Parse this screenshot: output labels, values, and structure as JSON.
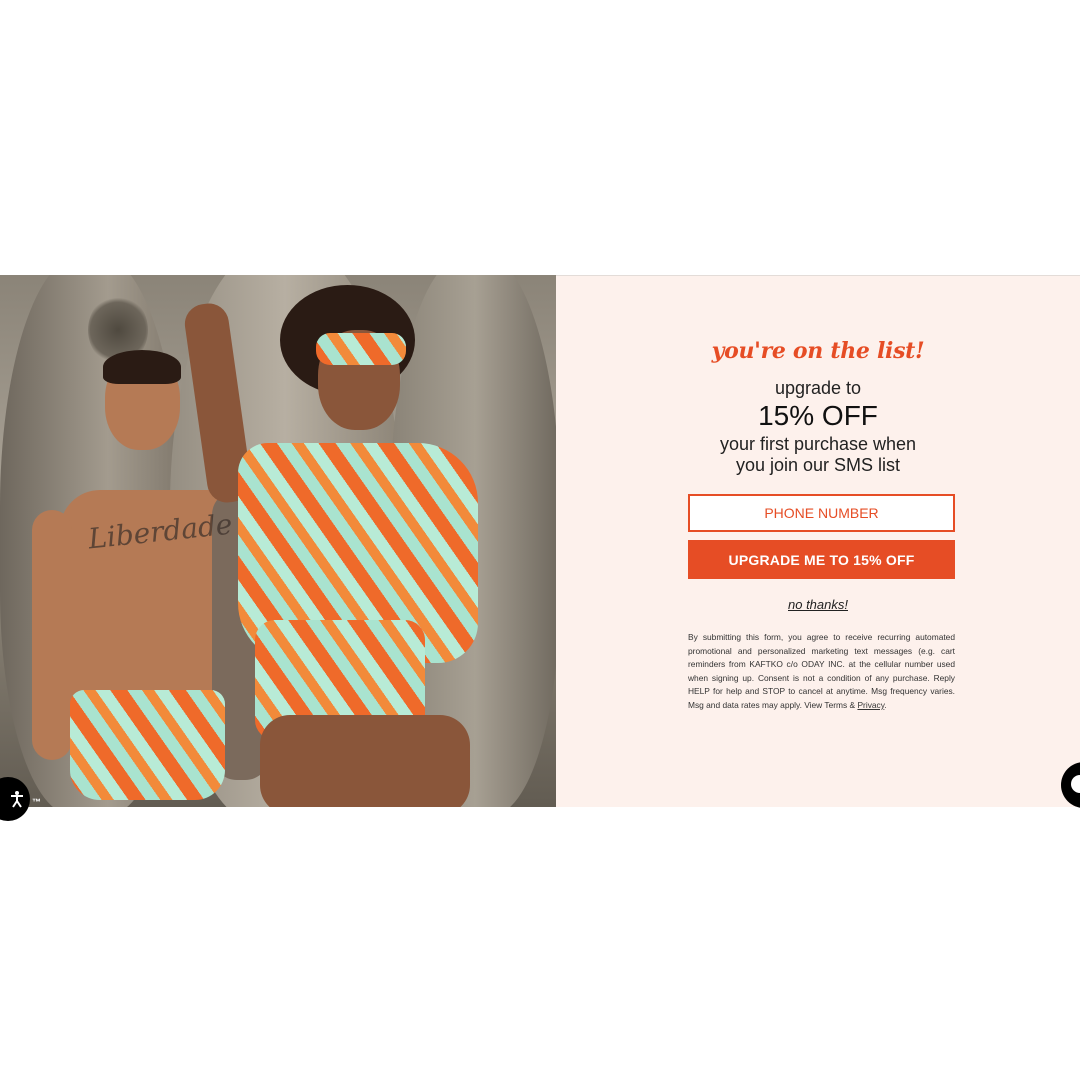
{
  "popup": {
    "headline": "you're on the list!",
    "upgrade_to": "upgrade to",
    "discount": "15% OFF",
    "subcopy_line1": "your first purchase when",
    "subcopy_line2": "you join our SMS list",
    "phone_placeholder": "PHONE NUMBER",
    "cta_label": "UPGRADE ME TO 15% OFF",
    "decline_label": "no thanks!",
    "legal_text": "By submitting this form, you agree to receive recurring automated promotional and personalized marketing text messages (e.g. cart reminders from KAFTKO c/o ODAY INC. at the cellular number used when signing up. Consent is not a condition of any purchase. Reply HELP for help and STOP to cancel at anytime. Msg frequency varies. Msg and data rates may apply. View ",
    "terms_label": "Terms",
    "amp": " & ",
    "privacy_label": "Privacy",
    "period": "."
  },
  "photo": {
    "tattoo_text": "Liberdade"
  },
  "badges": {
    "tm_text": "™",
    "accessibility_icon": "accessibility-icon",
    "chat_icon": "chat-icon"
  },
  "colors": {
    "accent": "#e64d25",
    "panel_bg": "#fdf1ec"
  }
}
